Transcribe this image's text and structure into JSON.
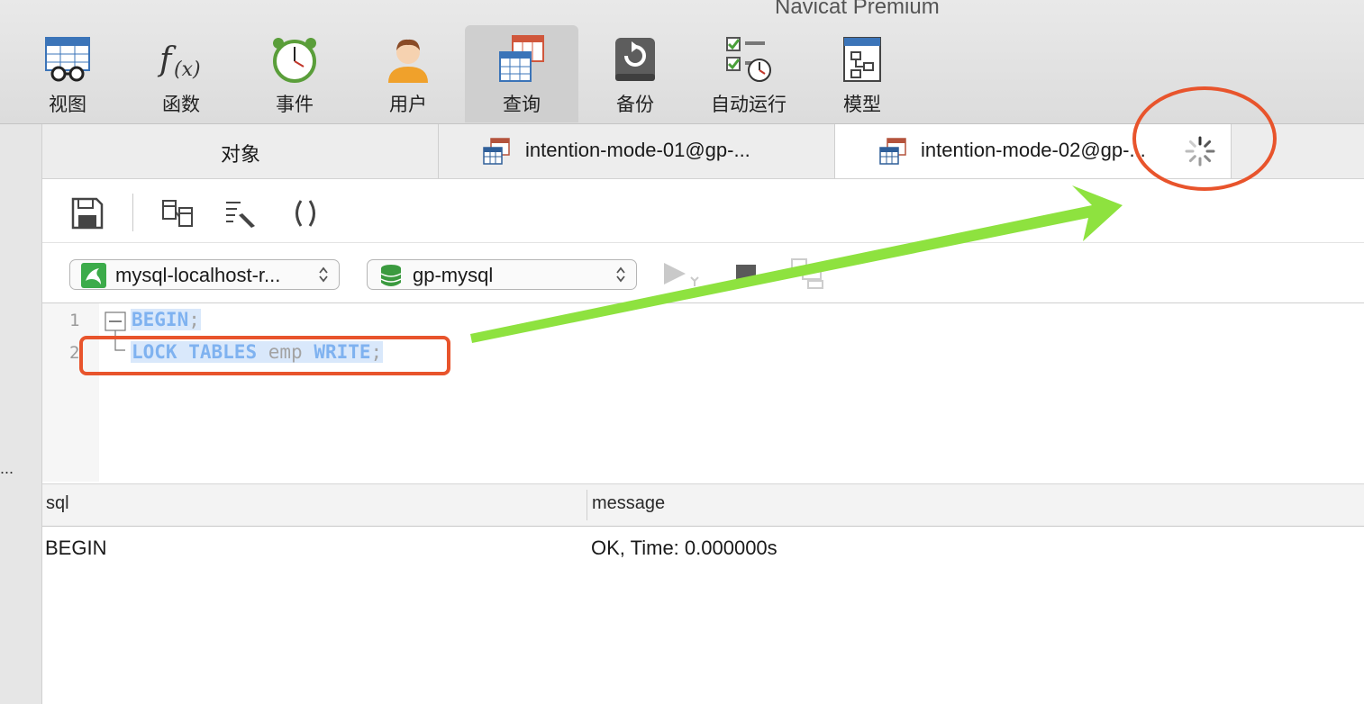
{
  "window": {
    "title": "Navicat Premium"
  },
  "toolbar": {
    "items": [
      {
        "label": "视图",
        "icon": "view-icon"
      },
      {
        "label": "函数",
        "icon": "function-icon"
      },
      {
        "label": "事件",
        "icon": "event-clock-icon"
      },
      {
        "label": "用户",
        "icon": "user-icon"
      },
      {
        "label": "查询",
        "icon": "query-icon",
        "active": true
      },
      {
        "label": "备份",
        "icon": "backup-icon"
      },
      {
        "label": "自动运行",
        "icon": "automation-icon"
      },
      {
        "label": "模型",
        "icon": "model-icon"
      }
    ]
  },
  "sidebar": {
    "collapsed_indicator": "..."
  },
  "tabs": [
    {
      "label": "对象"
    },
    {
      "label": "intention-mode-01@gp-..."
    },
    {
      "label": "intention-mode-02@gp-...",
      "active": true,
      "loading": true
    }
  ],
  "connection": {
    "server": "mysql-localhost-r...",
    "database": "gp-mysql"
  },
  "editor": {
    "lines": [
      {
        "num": "1",
        "tokens": [
          {
            "t": "BEGIN",
            "k": "kw"
          },
          {
            "t": ";",
            "k": "pl"
          }
        ]
      },
      {
        "num": "2",
        "tokens": [
          {
            "t": "LOCK",
            "k": "kw"
          },
          {
            "t": " ",
            "k": "pl"
          },
          {
            "t": "TABLES",
            "k": "kw"
          },
          {
            "t": " emp ",
            "k": "pl"
          },
          {
            "t": "WRITE",
            "k": "kw"
          },
          {
            "t": ";",
            "k": "pl"
          }
        ]
      }
    ]
  },
  "results": {
    "columns": [
      "sql",
      "message"
    ],
    "rows": [
      [
        "BEGIN",
        "OK, Time: 0.000000s"
      ]
    ]
  },
  "annotations": {
    "highlight_color": "#e8542c",
    "arrow_color": "#8ee23f"
  }
}
